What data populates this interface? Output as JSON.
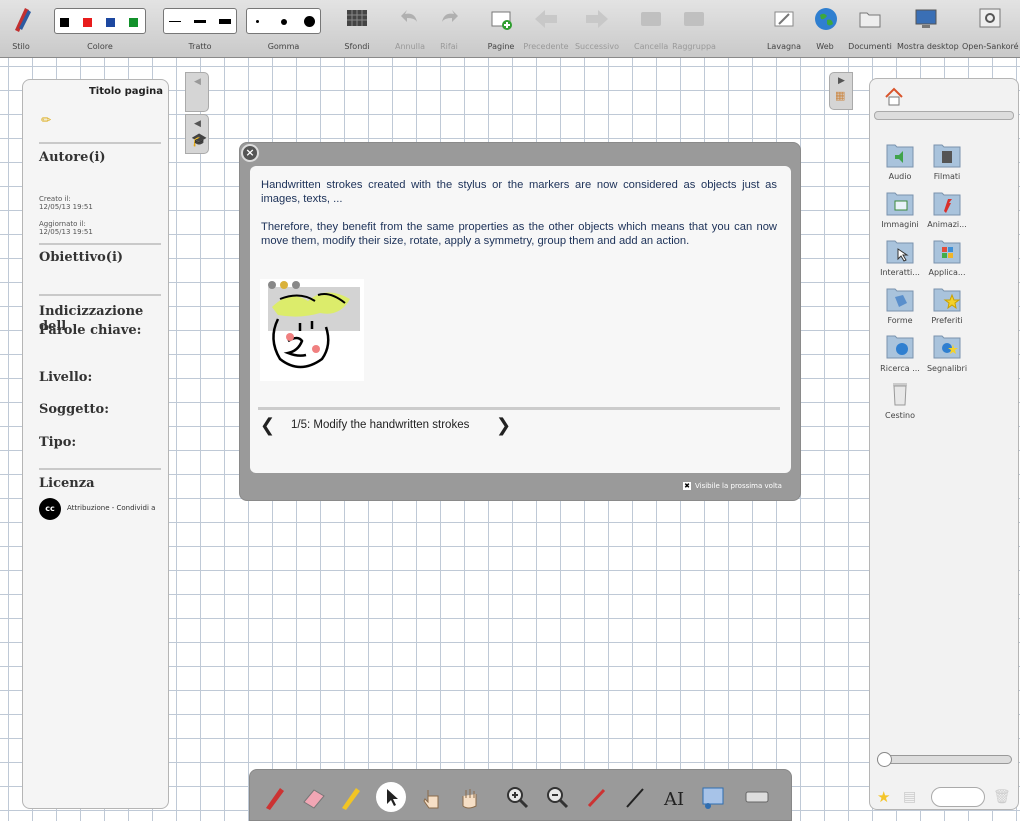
{
  "toolbar": {
    "stylus": "Stilo",
    "color": "Colore",
    "stroke": "Tratto",
    "eraser": "Gomma",
    "backgrounds": "Sfondi",
    "undo": "Annulla",
    "redo": "Rifai",
    "pages": "Pagine",
    "previous": "Precedente",
    "next": "Successivo",
    "clear": "Cancella",
    "group": "Raggruppa",
    "board": "Lavagna",
    "web": "Web",
    "documents": "Documenti",
    "show_desktop": "Mostra desktop",
    "open_sankore": "Open-Sankoré",
    "colors": [
      "#000000",
      "#e81c1c",
      "#1d48a0",
      "#12912b"
    ]
  },
  "left_panel": {
    "page_title": "Titolo pagina",
    "authors": "Autore(i)",
    "created_label": "Creato il:",
    "created_date": "12/05/13 19:51",
    "updated_label": "Aggiornato il:",
    "updated_date": "12/05/13 19:51",
    "objectives": "Obiettivo(i)",
    "indexing": "Indicizzazione dell",
    "keywords": "Parole chiave:",
    "level": "Livello:",
    "subject": "Soggetto:",
    "type": "Tipo:",
    "license": "Licenza",
    "license_text": "Attribuzione - Condividi a"
  },
  "right_panel": {
    "folders": [
      "Audio",
      "Filmati",
      "Immagini",
      "Animazi...",
      "Interatti...",
      "Applica...",
      "Forme",
      "Preferiti",
      "Ricerca ...",
      "Segnalibri",
      "Cestino"
    ]
  },
  "dialog": {
    "p1": "Handwritten strokes created with the stylus or the markers are now considered as objects just as images, texts, ...",
    "p2": "Therefore, they benefit from the same properties as the other objects which means that you can now move them, modify their size, rotate, apply a symmetry, group them and add an action.",
    "step": "1/5: Modify the handwritten strokes",
    "show_next_time": "Visibile la prossima volta"
  }
}
